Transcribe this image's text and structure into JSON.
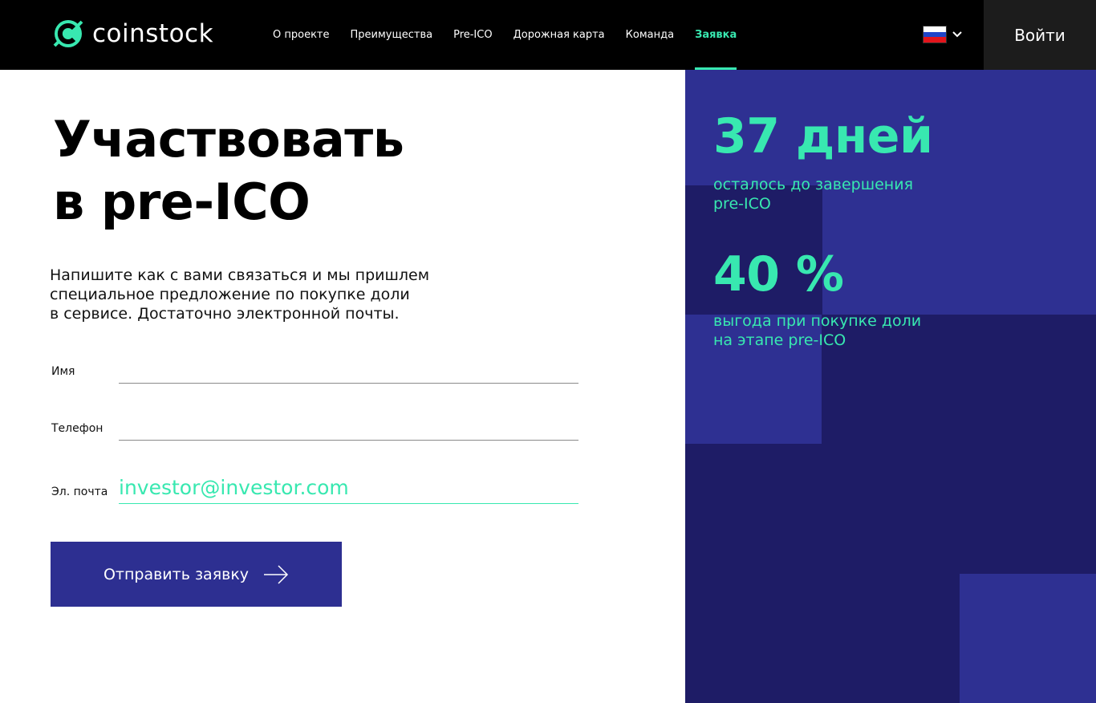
{
  "header": {
    "logo_text": "coinstock",
    "nav": [
      {
        "label": "О проекте",
        "active": false
      },
      {
        "label": "Преимущества",
        "active": false
      },
      {
        "label": "Pre-ICO",
        "active": false
      },
      {
        "label": "Дорожная карта",
        "active": false
      },
      {
        "label": "Команда",
        "active": false
      },
      {
        "label": "Заявка",
        "active": true
      }
    ],
    "language_icon": "russia-flag-icon",
    "login_label": "Войти"
  },
  "main": {
    "title_line1": "Участвовать",
    "title_line2": "в pre-ICO",
    "description_line1": "Напишите как с вами связаться и мы пришлем",
    "description_line2": "специальное предложение по покупке доли",
    "description_line3": "в сервисе. Достаточно электронной почты.",
    "form": {
      "name_label": "Имя",
      "name_value": "",
      "phone_label": "Телефон",
      "phone_value": "",
      "email_label": "Эл. почта",
      "email_value": "investor@investor.com"
    },
    "submit_label": "Отправить заявку",
    "submit_icon": "arrow-right-icon"
  },
  "stats": [
    {
      "number": "37 дней",
      "caption_line1": "осталось до завершения",
      "caption_line2": "pre-ICO"
    },
    {
      "number": "40 %",
      "caption_line1": "выгода при покупке доли",
      "caption_line2": "на этапе pre-ICO"
    }
  ],
  "colors": {
    "accent": "#38e8b0",
    "button_bg": "#2d2f91",
    "panel_dark": "#1e1c66",
    "panel_light": "#2e3092",
    "header_bg": "#000000"
  }
}
